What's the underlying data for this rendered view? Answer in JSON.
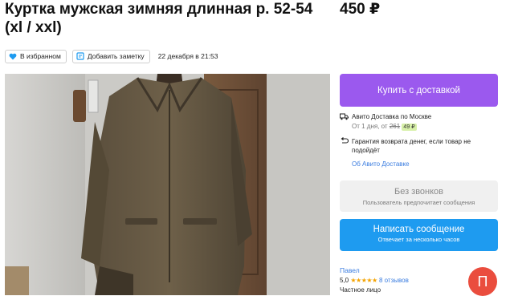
{
  "listing": {
    "title": "Куртка мужская зимняя длинная р. 52-54 (xl / xxl)",
    "price": "450 ₽",
    "favorite_label": "В избранном",
    "note_label": "Добавить заметку",
    "date": "22 декабря в 21:53"
  },
  "purchase": {
    "buy_label": "Купить с доставкой",
    "delivery_title": "Авито Доставка по Москве",
    "delivery_from": "От 1 дня, от",
    "delivery_old_price": "261",
    "delivery_new_price": "49 ₽",
    "guarantee": "Гарантия возврата денег, если товар не подойдёт",
    "about_link": "Об Авито Доставке"
  },
  "contact": {
    "no_calls_title": "Без звонков",
    "no_calls_sub": "Пользователь предпочитает сообщения",
    "message_title": "Написать сообщение",
    "message_sub": "Отвечает за несколько часов"
  },
  "seller": {
    "name": "Павел",
    "rating": "5,0",
    "stars": "★★★★★",
    "reviews": "8 отзывов",
    "type": "Частное лицо",
    "avatar_letter": "П"
  },
  "colors": {
    "buy_button": "#9b59ee",
    "message_button": "#1e9bf0",
    "avatar": "#ea4d3e",
    "favorite_heart": "#1e9bf0"
  }
}
